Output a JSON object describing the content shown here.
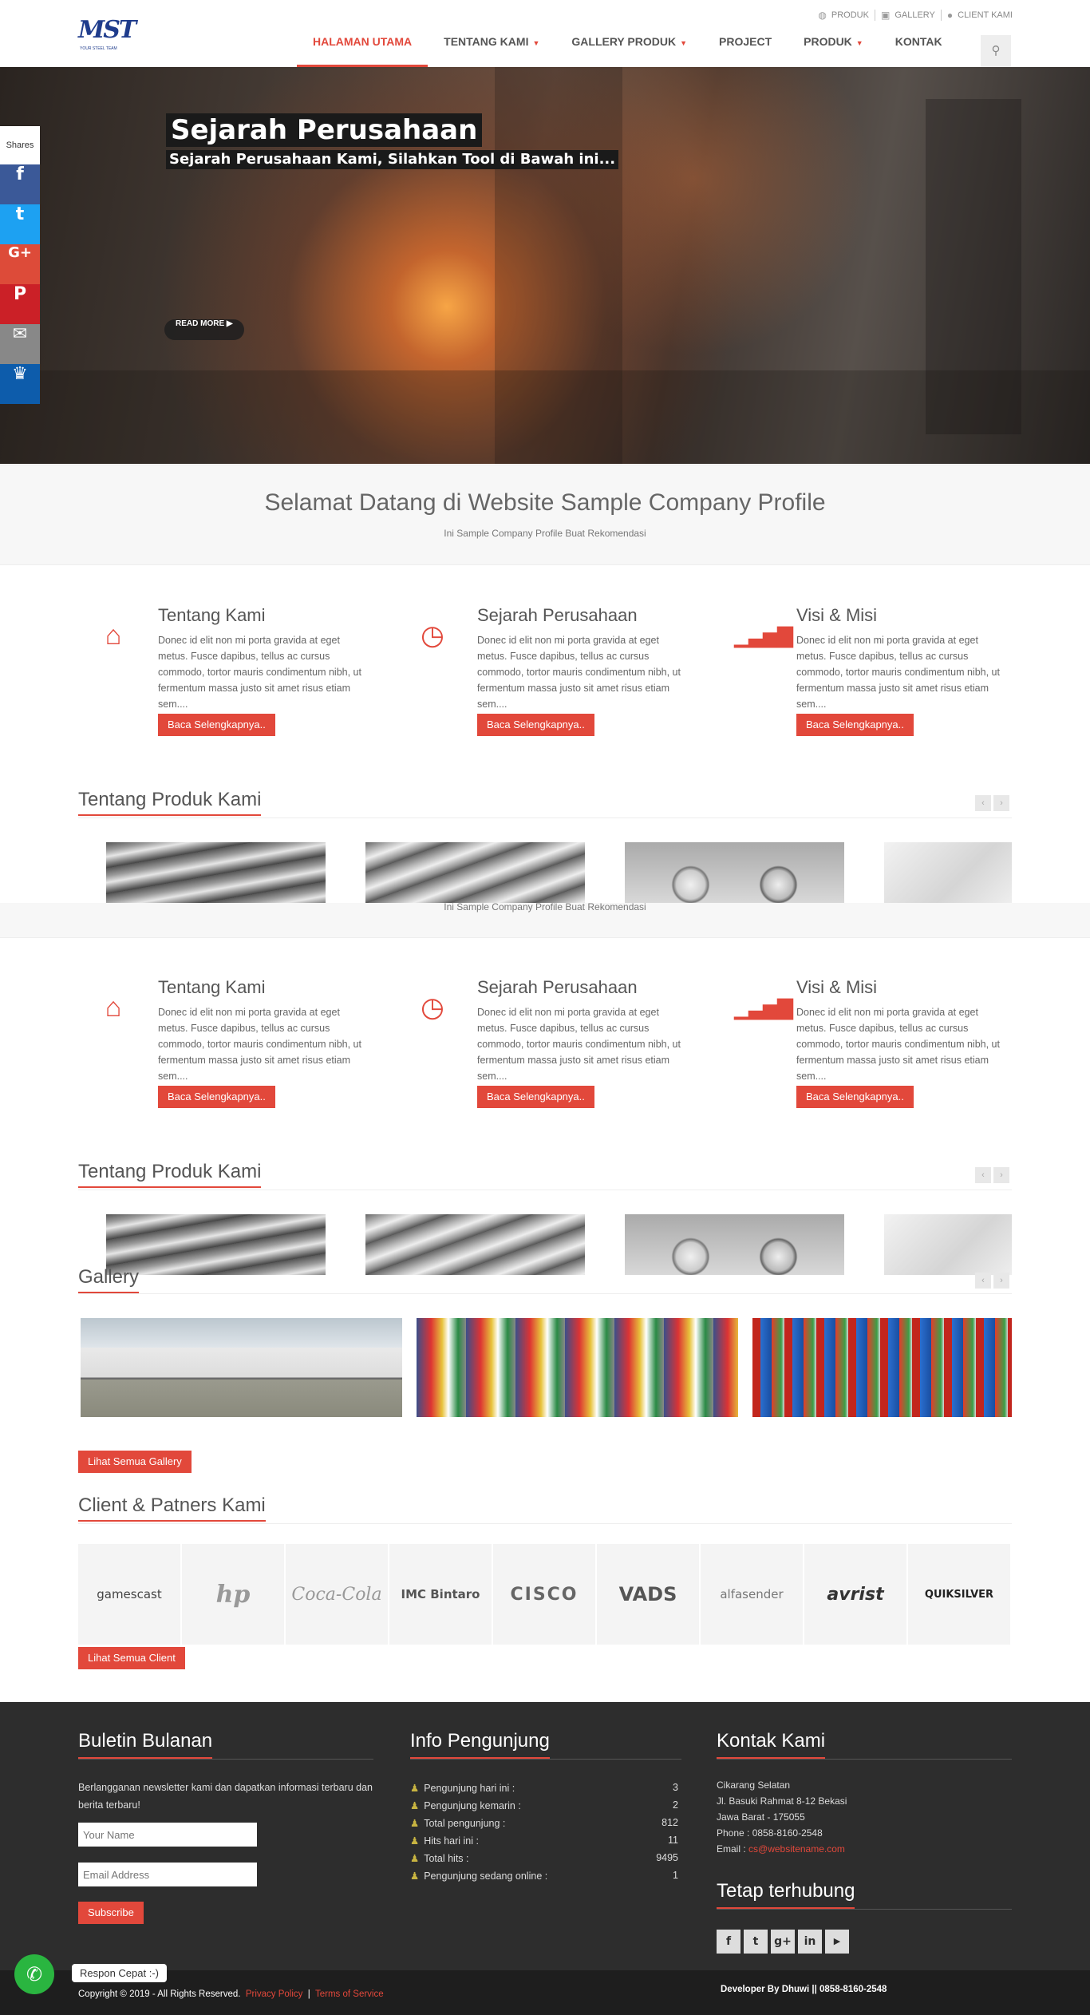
{
  "header": {
    "logo_text": "MST",
    "logo_sub": "YOUR STEEL TEAM",
    "toplinks": [
      {
        "label": "PRODUK",
        "icon": "globe-icon"
      },
      {
        "label": "GALLERY",
        "icon": "book-icon"
      },
      {
        "label": "CLIENT KAMI",
        "icon": "user-icon"
      }
    ],
    "nav": [
      {
        "label": "HALAMAN UTAMA",
        "active": true
      },
      {
        "label": "TENTANG KAMI",
        "dropdown": true
      },
      {
        "label": "GALLERY PRODUK",
        "dropdown": true
      },
      {
        "label": "PROJECT"
      },
      {
        "label": "PRODUK",
        "dropdown": true
      },
      {
        "label": "KONTAK"
      }
    ],
    "search_icon": "search-icon"
  },
  "shares": {
    "label": "Shares",
    "items": [
      {
        "name": "facebook",
        "glyph": "f",
        "color": "#3b5998"
      },
      {
        "name": "twitter",
        "glyph": "t",
        "color": "#1da1f2"
      },
      {
        "name": "google-plus",
        "glyph": "G+",
        "color": "#dd4b39"
      },
      {
        "name": "pinterest",
        "glyph": "P",
        "color": "#cb2027"
      },
      {
        "name": "email",
        "glyph": "✉",
        "color": "#888888"
      },
      {
        "name": "sumome",
        "glyph": "♛",
        "color": "#0d5cab"
      }
    ]
  },
  "hero": {
    "title": "Sejarah Perusahaan",
    "subtitle": "Sejarah Perusahaan Kami, Silahkan Tool di Bawah ini...",
    "read_more": "READ MORE"
  },
  "welcome": {
    "title": "Selamat Datang di Website Sample Company Profile",
    "subtitle": "Ini Sample Company Profile Buat Rekomendasi"
  },
  "features": [
    {
      "title": "Tentang Kami",
      "icon": "home-icon",
      "text": "Donec id elit non mi porta gravida at eget metus. Fusce dapibus, tellus ac cursus commodo, tortor mauris condimentum nibh, ut fermentum massa justo sit amet risus etiam sem....",
      "button": "Baca Selengkapnya.."
    },
    {
      "title": "Sejarah Perusahaan",
      "icon": "clock-icon",
      "text": "Donec id elit non mi porta gravida at eget metus. Fusce dapibus, tellus ac cursus commodo, tortor mauris condimentum nibh, ut fermentum massa justo sit amet risus etiam sem....",
      "button": "Baca Selengkapnya.."
    },
    {
      "title": "Visi & Misi",
      "icon": "signal-icon",
      "text": "Donec id elit non mi porta gravida at eget metus. Fusce dapibus, tellus ac cursus commodo, tortor mauris condimentum nibh, ut fermentum massa justo sit amet risus etiam sem....",
      "button": "Baca Selengkapnya.."
    }
  ],
  "products": {
    "title": "Tentang Produk Kami",
    "prev": "‹",
    "next": "›"
  },
  "gallery": {
    "title": "Gallery",
    "button": "Lihat Semua Gallery"
  },
  "clients": {
    "title": "Client & Patners Kami",
    "logos": [
      "gamescast",
      "hp",
      "Coca-Cola",
      "IMC Bintaro",
      "CISCO",
      "VADS",
      "alfasender",
      "avrist",
      "QUIKSILVER"
    ],
    "button": "Lihat Semua Client"
  },
  "footer": {
    "newsletter": {
      "title": "Buletin Bulanan",
      "text": "Berlangganan newsletter kami dan dapatkan informasi terbaru dan berita terbaru!",
      "name_placeholder": "Your Name",
      "email_placeholder": "Email Address",
      "button": "Subscribe"
    },
    "visitors": {
      "title": "Info Pengunjung",
      "rows": [
        {
          "label": "Pengunjung hari ini :",
          "value": "3"
        },
        {
          "label": "Pengunjung kemarin :",
          "value": "2"
        },
        {
          "label": "Total pengunjung :",
          "value": "812"
        },
        {
          "label": "Hits hari ini :",
          "value": "11"
        },
        {
          "label": "Total hits :",
          "value": "9495"
        },
        {
          "label": "Pengunjung sedang online :",
          "value": "1"
        }
      ]
    },
    "contact": {
      "title": "Kontak Kami",
      "line1": "Cikarang Selatan",
      "line2": "Jl. Basuki Rahmat 8-12 Bekasi",
      "line3": "Jawa Barat - 175055",
      "phone": "Phone : 0858-8160-2548",
      "email_label": "Email : ",
      "email": "cs@websitename.com"
    },
    "connect": {
      "title": "Tetap terhubung",
      "icons": [
        {
          "name": "facebook-icon",
          "glyph": "f"
        },
        {
          "name": "twitter-icon",
          "glyph": "t"
        },
        {
          "name": "google-plus-icon",
          "glyph": "g+"
        },
        {
          "name": "linkedin-icon",
          "glyph": "in"
        },
        {
          "name": "youtube-icon",
          "glyph": "▶"
        }
      ]
    }
  },
  "bottom": {
    "copyright": "Copyright © 2019 - All Rights Reserved.",
    "privacy": "Privacy Policy",
    "separator": "|",
    "terms": "Terms of Service",
    "developer": "Developer By Dhuwi || 0858-8160-2548"
  },
  "whatsapp": {
    "tooltip": "Respon Cepat :-)",
    "icon": "whatsapp-icon"
  },
  "colors": {
    "accent": "#e2483b",
    "footer_bg": "#2d2d2d",
    "bottom_bg": "#1e1e1e"
  }
}
